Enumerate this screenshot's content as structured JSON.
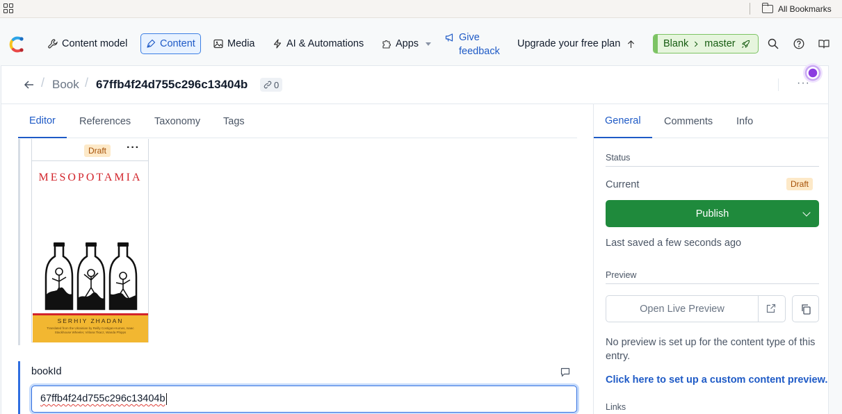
{
  "browser": {
    "bookmarks_label": "All Bookmarks"
  },
  "nav": {
    "content_model": "Content model",
    "content": "Content",
    "media": "Media",
    "ai": "AI & Automations",
    "apps": "Apps",
    "feedback_line1": "Give",
    "feedback_line2": "feedback",
    "upgrade": "Upgrade your free plan",
    "env_space": "Blank",
    "env_branch": "master",
    "brand_colors": {
      "accent": "#1e5ac6",
      "publish": "#1f8a3c",
      "env": "#7cc363"
    }
  },
  "entry": {
    "content_type": "Book",
    "id": "67ffb4f24d755c296c13404b",
    "link_count": "0"
  },
  "editor_tabs": [
    "Editor",
    "References",
    "Taxonomy",
    "Tags"
  ],
  "asset_card": {
    "status": "Draft",
    "cover_title": "MESOPOTAMIA",
    "cover_author": "SERHIY ZHADAN",
    "cover_subtitle": "Translated from the Ukrainian by Reilly Costigan-Humes, Isaac Stackhouse Wheeler, Virlana Tkacz, Wanda Phipps"
  },
  "field": {
    "label": "bookId",
    "value": "67ffb4f24d755c296c13404b"
  },
  "sidebar": {
    "tabs": [
      "General",
      "Comments",
      "Info"
    ],
    "status_section": "Status",
    "current_label": "Current",
    "current_status": "Draft",
    "publish_label": "Publish",
    "last_saved": "Last saved a few seconds ago",
    "preview_section": "Preview",
    "open_preview": "Open Live Preview",
    "no_preview_text": "No preview is set up for the content type of this entry.",
    "custom_preview_link": "Click here to set up a custom content preview.",
    "links_section": "Links"
  }
}
